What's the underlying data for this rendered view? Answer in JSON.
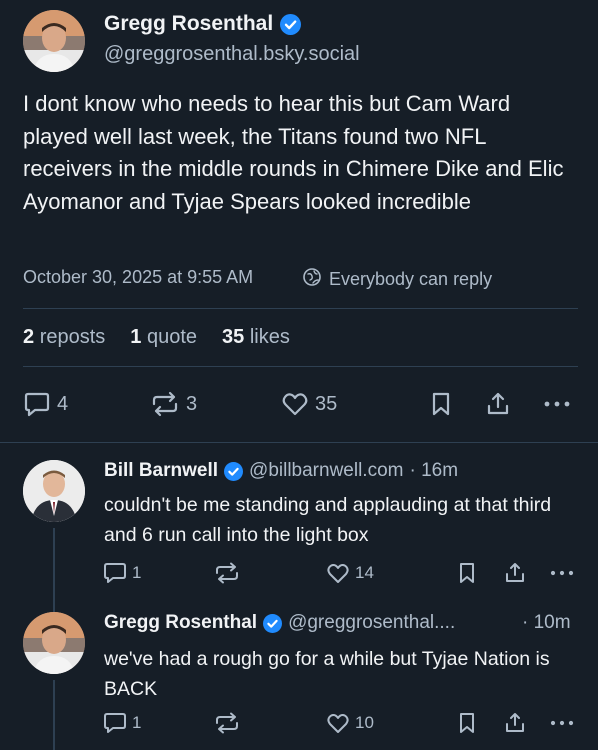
{
  "main_post": {
    "author_name": "Gregg Rosenthal",
    "author_handle": "@greggrosenthal.bsky.social",
    "text": "I dont know who needs to hear this but Cam Ward played well last week, the Titans found two NFL receivers in the middle rounds in Chimere Dike and Elic Ayomanor and Tyjae Spears looked incredible",
    "timestamp": "October 30, 2025 at 9:55 AM",
    "reply_setting": "Everybody can reply",
    "stats": {
      "reposts_count": "2",
      "reposts_label": "reposts",
      "quotes_count": "1",
      "quotes_label": "quote",
      "likes_count": "35",
      "likes_label": "likes"
    },
    "actions": {
      "reply_count": "4",
      "repost_count": "3",
      "like_count": "35"
    }
  },
  "replies": [
    {
      "author_name": "Bill Barnwell",
      "author_handle": "@billbarnwell.com",
      "time": "· 16m",
      "text": "couldn't be me standing and applauding at that third and 6 run call into the light box",
      "reply_count": "1",
      "repost_count": "",
      "like_count": "14"
    },
    {
      "author_name": "Gregg Rosenthal",
      "author_handle": "@greggrosenthal....",
      "time": "· 10m",
      "text": "we've had a rough go for a while but Tyjae Nation is BACK",
      "reply_count": "1",
      "repost_count": "",
      "like_count": "10"
    }
  ],
  "colors": {
    "background": "#161e27",
    "text": "#f1f3f5",
    "muted": "#aebbc9",
    "divider": "#2e4052",
    "verified": "#208bfe"
  },
  "icons": [
    "verified-icon",
    "globe-icon",
    "reply-icon",
    "repost-icon",
    "like-icon",
    "bookmark-icon",
    "share-icon",
    "more-icon"
  ]
}
